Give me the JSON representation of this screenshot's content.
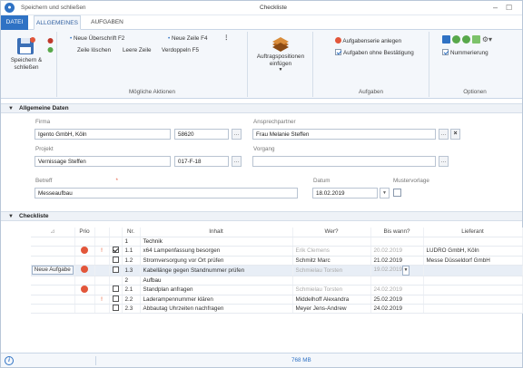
{
  "window": {
    "app_label": "Speichern und schließen",
    "title": "Checkliste",
    "minimize": "–",
    "close": "☐"
  },
  "tabs": [
    {
      "label": "DATEI"
    },
    {
      "label": "ALLGEMEINES"
    },
    {
      "label": "AUFGABEN"
    }
  ],
  "ribbon": {
    "save_label_1": "Speichern &",
    "save_label_2": "schließen",
    "new_heading_label": "Neue Überschrift F2",
    "new_row_label": "Neue Zeile F4",
    "delete_row_label": "Zeile löschen",
    "empty_row_label": "Leere Zeile",
    "duplicate_row_label": "Verdoppeln F5",
    "group_actions_label": "Mögliche Aktionen",
    "insert_positions_label_1": "Auftragspositionen",
    "insert_positions_label_2": "einfügen",
    "create_series_label": "Aufgabenserie anlegen",
    "tasks_without_confirm_label": "Aufgaben ohne Bestätigung",
    "group_tasks_label": "Aufgaben",
    "numbering_label": "Nummerierung",
    "group_options_label": "Optionen"
  },
  "general": {
    "section_title": "Allgemeine Daten",
    "firma_label": "Firma",
    "firma_value": "Igento GmbH, Köln",
    "firma_number": "58620",
    "contact_label": "Ansprechpartner",
    "contact_value": "Frau Melanie Steffen",
    "projekt_label": "Projekt",
    "projekt_value": "Vernissage Steffen",
    "projekt_number": "017-F-18",
    "vorgang_label": "Vorgang",
    "vorgang_value": "",
    "betreff_label": "Betreff",
    "required_mark": "*",
    "betreff_value": "Messeaufbau",
    "datum_label": "Datum",
    "datum_value": "18.02.2019",
    "template_label": "Mustervorlage"
  },
  "checklist": {
    "section_title": "Checkliste",
    "headers": {
      "prio": "Prio",
      "nr": "Nr.",
      "inhalt": "Inhalt",
      "wer": "Wer?",
      "bis": "Bis wann?",
      "lieferant": "Lieferant"
    },
    "new_task_button": "Neue Aufgabe",
    "rows": [
      {
        "nr": "1",
        "inhalt": "Technik",
        "wer": "",
        "bis": "",
        "lieferant": ""
      },
      {
        "nr": "1.1",
        "inhalt": "x64 Lampenfassung besorgen",
        "wer": "Erik Clemens",
        "bis": "20.02.2019",
        "lieferant": "LUDRO GmbH, Köln"
      },
      {
        "nr": "1.2",
        "inhalt": "Stromversorgung vor Ort prüfen",
        "wer": "Schmitz Marc",
        "bis": "21.02.2019",
        "lieferant": "Messe Düsseldorf GmbH"
      },
      {
        "nr": "1.3",
        "inhalt": "Kabellänge gegen Standnummer prüfen",
        "wer": "Schmielau Torsten",
        "bis": "19.02.2019",
        "lieferant": ""
      },
      {
        "nr": "2",
        "inhalt": "Aufbau",
        "wer": "",
        "bis": "",
        "lieferant": ""
      },
      {
        "nr": "2.1",
        "inhalt": "Standplan anfragen",
        "wer": "Schmielau Torsten",
        "bis": "24.02.2019",
        "lieferant": ""
      },
      {
        "nr": "2.2",
        "inhalt": "Laderampennummer klären",
        "wer": "Middelhoff Alexandra",
        "bis": "25.02.2019",
        "lieferant": ""
      },
      {
        "nr": "2.3",
        "inhalt": "Abbautag Uhrzeiten nachfragen",
        "wer": "Meyer Jens-Andrew",
        "bis": "24.02.2019",
        "lieferant": ""
      }
    ]
  },
  "status": {
    "info": "i",
    "memory": "768 MB"
  },
  "colors": {
    "accent": "#2f72c4",
    "warning": "#e2563a"
  }
}
